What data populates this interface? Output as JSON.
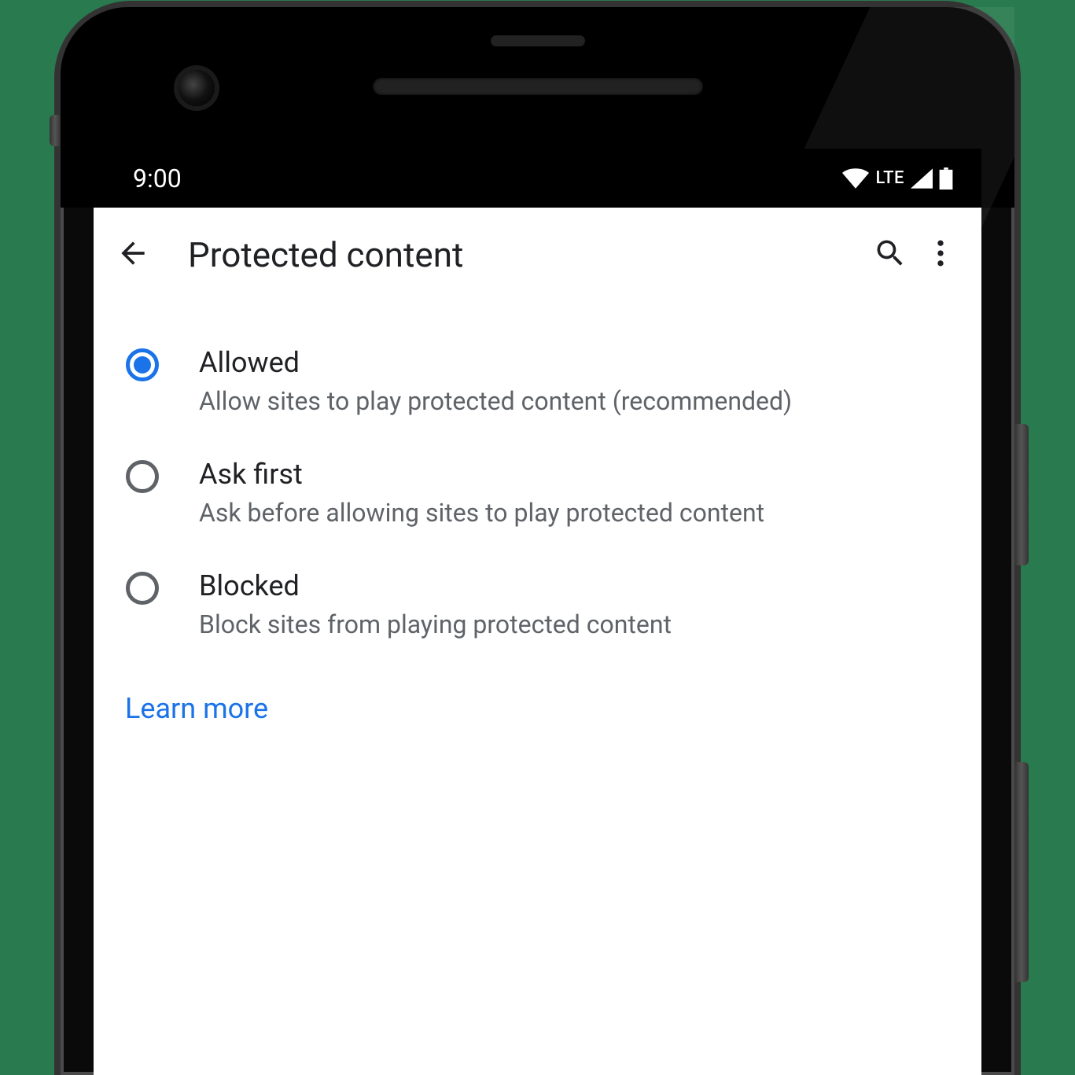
{
  "status_bar": {
    "time": "9:00",
    "network_label": "LTE"
  },
  "app_bar": {
    "title": "Protected content"
  },
  "options": [
    {
      "title": "Allowed",
      "description": "Allow sites to play protected content (recommended)",
      "selected": true
    },
    {
      "title": "Ask first",
      "description": "Ask before allowing sites to play protected content",
      "selected": false
    },
    {
      "title": "Blocked",
      "description": "Block sites from playing protected content",
      "selected": false
    }
  ],
  "learn_more_label": "Learn more"
}
